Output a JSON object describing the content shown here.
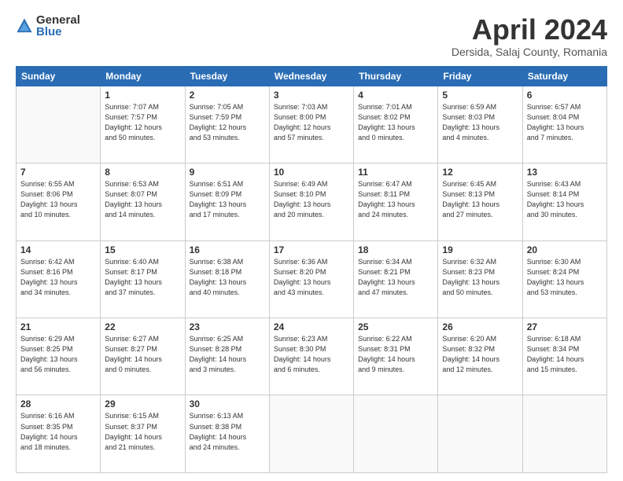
{
  "header": {
    "logo_general": "General",
    "logo_blue": "Blue",
    "title": "April 2024",
    "location": "Dersida, Salaj County, Romania"
  },
  "days_of_week": [
    "Sunday",
    "Monday",
    "Tuesday",
    "Wednesday",
    "Thursday",
    "Friday",
    "Saturday"
  ],
  "weeks": [
    [
      {
        "day": "",
        "info": ""
      },
      {
        "day": "1",
        "info": "Sunrise: 7:07 AM\nSunset: 7:57 PM\nDaylight: 12 hours\nand 50 minutes."
      },
      {
        "day": "2",
        "info": "Sunrise: 7:05 AM\nSunset: 7:59 PM\nDaylight: 12 hours\nand 53 minutes."
      },
      {
        "day": "3",
        "info": "Sunrise: 7:03 AM\nSunset: 8:00 PM\nDaylight: 12 hours\nand 57 minutes."
      },
      {
        "day": "4",
        "info": "Sunrise: 7:01 AM\nSunset: 8:02 PM\nDaylight: 13 hours\nand 0 minutes."
      },
      {
        "day": "5",
        "info": "Sunrise: 6:59 AM\nSunset: 8:03 PM\nDaylight: 13 hours\nand 4 minutes."
      },
      {
        "day": "6",
        "info": "Sunrise: 6:57 AM\nSunset: 8:04 PM\nDaylight: 13 hours\nand 7 minutes."
      }
    ],
    [
      {
        "day": "7",
        "info": "Sunrise: 6:55 AM\nSunset: 8:06 PM\nDaylight: 13 hours\nand 10 minutes."
      },
      {
        "day": "8",
        "info": "Sunrise: 6:53 AM\nSunset: 8:07 PM\nDaylight: 13 hours\nand 14 minutes."
      },
      {
        "day": "9",
        "info": "Sunrise: 6:51 AM\nSunset: 8:09 PM\nDaylight: 13 hours\nand 17 minutes."
      },
      {
        "day": "10",
        "info": "Sunrise: 6:49 AM\nSunset: 8:10 PM\nDaylight: 13 hours\nand 20 minutes."
      },
      {
        "day": "11",
        "info": "Sunrise: 6:47 AM\nSunset: 8:11 PM\nDaylight: 13 hours\nand 24 minutes."
      },
      {
        "day": "12",
        "info": "Sunrise: 6:45 AM\nSunset: 8:13 PM\nDaylight: 13 hours\nand 27 minutes."
      },
      {
        "day": "13",
        "info": "Sunrise: 6:43 AM\nSunset: 8:14 PM\nDaylight: 13 hours\nand 30 minutes."
      }
    ],
    [
      {
        "day": "14",
        "info": "Sunrise: 6:42 AM\nSunset: 8:16 PM\nDaylight: 13 hours\nand 34 minutes."
      },
      {
        "day": "15",
        "info": "Sunrise: 6:40 AM\nSunset: 8:17 PM\nDaylight: 13 hours\nand 37 minutes."
      },
      {
        "day": "16",
        "info": "Sunrise: 6:38 AM\nSunset: 8:18 PM\nDaylight: 13 hours\nand 40 minutes."
      },
      {
        "day": "17",
        "info": "Sunrise: 6:36 AM\nSunset: 8:20 PM\nDaylight: 13 hours\nand 43 minutes."
      },
      {
        "day": "18",
        "info": "Sunrise: 6:34 AM\nSunset: 8:21 PM\nDaylight: 13 hours\nand 47 minutes."
      },
      {
        "day": "19",
        "info": "Sunrise: 6:32 AM\nSunset: 8:23 PM\nDaylight: 13 hours\nand 50 minutes."
      },
      {
        "day": "20",
        "info": "Sunrise: 6:30 AM\nSunset: 8:24 PM\nDaylight: 13 hours\nand 53 minutes."
      }
    ],
    [
      {
        "day": "21",
        "info": "Sunrise: 6:29 AM\nSunset: 8:25 PM\nDaylight: 13 hours\nand 56 minutes."
      },
      {
        "day": "22",
        "info": "Sunrise: 6:27 AM\nSunset: 8:27 PM\nDaylight: 14 hours\nand 0 minutes."
      },
      {
        "day": "23",
        "info": "Sunrise: 6:25 AM\nSunset: 8:28 PM\nDaylight: 14 hours\nand 3 minutes."
      },
      {
        "day": "24",
        "info": "Sunrise: 6:23 AM\nSunset: 8:30 PM\nDaylight: 14 hours\nand 6 minutes."
      },
      {
        "day": "25",
        "info": "Sunrise: 6:22 AM\nSunset: 8:31 PM\nDaylight: 14 hours\nand 9 minutes."
      },
      {
        "day": "26",
        "info": "Sunrise: 6:20 AM\nSunset: 8:32 PM\nDaylight: 14 hours\nand 12 minutes."
      },
      {
        "day": "27",
        "info": "Sunrise: 6:18 AM\nSunset: 8:34 PM\nDaylight: 14 hours\nand 15 minutes."
      }
    ],
    [
      {
        "day": "28",
        "info": "Sunrise: 6:16 AM\nSunset: 8:35 PM\nDaylight: 14 hours\nand 18 minutes."
      },
      {
        "day": "29",
        "info": "Sunrise: 6:15 AM\nSunset: 8:37 PM\nDaylight: 14 hours\nand 21 minutes."
      },
      {
        "day": "30",
        "info": "Sunrise: 6:13 AM\nSunset: 8:38 PM\nDaylight: 14 hours\nand 24 minutes."
      },
      {
        "day": "",
        "info": ""
      },
      {
        "day": "",
        "info": ""
      },
      {
        "day": "",
        "info": ""
      },
      {
        "day": "",
        "info": ""
      }
    ]
  ]
}
